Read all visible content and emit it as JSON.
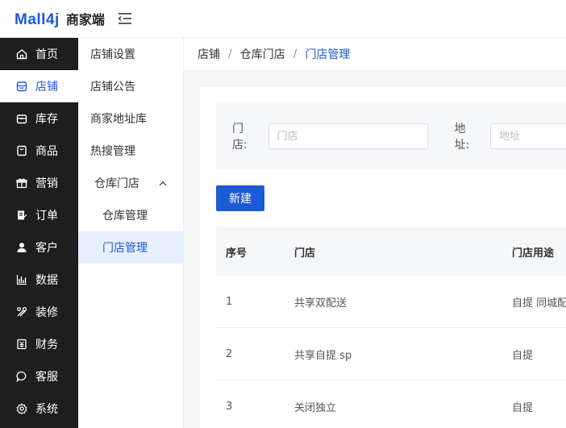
{
  "app": {
    "logo": "Mall4j",
    "subtitle": "商家端"
  },
  "sidebar": {
    "items": [
      {
        "label": "首页",
        "icon": "home-icon"
      },
      {
        "label": "店铺",
        "icon": "shop-icon"
      },
      {
        "label": "库存",
        "icon": "inventory-icon"
      },
      {
        "label": "商品",
        "icon": "product-icon"
      },
      {
        "label": "营销",
        "icon": "gift-icon"
      },
      {
        "label": "订单",
        "icon": "order-icon"
      },
      {
        "label": "客户",
        "icon": "user-icon"
      },
      {
        "label": "数据",
        "icon": "chart-icon"
      },
      {
        "label": "装修",
        "icon": "tools-icon"
      },
      {
        "label": "财务",
        "icon": "finance-icon"
      },
      {
        "label": "客服",
        "icon": "chat-icon"
      },
      {
        "label": "系统",
        "icon": "gear-icon"
      }
    ],
    "active": "店铺"
  },
  "submenu": {
    "items": [
      "店铺设置",
      "店铺公告",
      "商家地址库",
      "热搜管理"
    ],
    "group": {
      "label": "仓库门店",
      "children": [
        "仓库管理",
        "门店管理"
      ]
    }
  },
  "breadcrumb": [
    "店铺",
    "仓库门店",
    "门店管理"
  ],
  "filter": {
    "store_label": "门店:",
    "store_placeholder": "门店",
    "address_label": "地址:",
    "address_placeholder": "地址"
  },
  "toolbar": {
    "new_label": "新建"
  },
  "table": {
    "headers": [
      "序号",
      "门店",
      "门店用途"
    ],
    "rows": [
      [
        "1",
        "共享双配送",
        "自提 同城配送"
      ],
      [
        "2",
        "共享自提 sp",
        "自提"
      ],
      [
        "3",
        "关闭独立",
        "自提"
      ]
    ]
  },
  "colors": {
    "accent": "#1c5ad6",
    "sidebar_bg": "#1e1e1e"
  }
}
